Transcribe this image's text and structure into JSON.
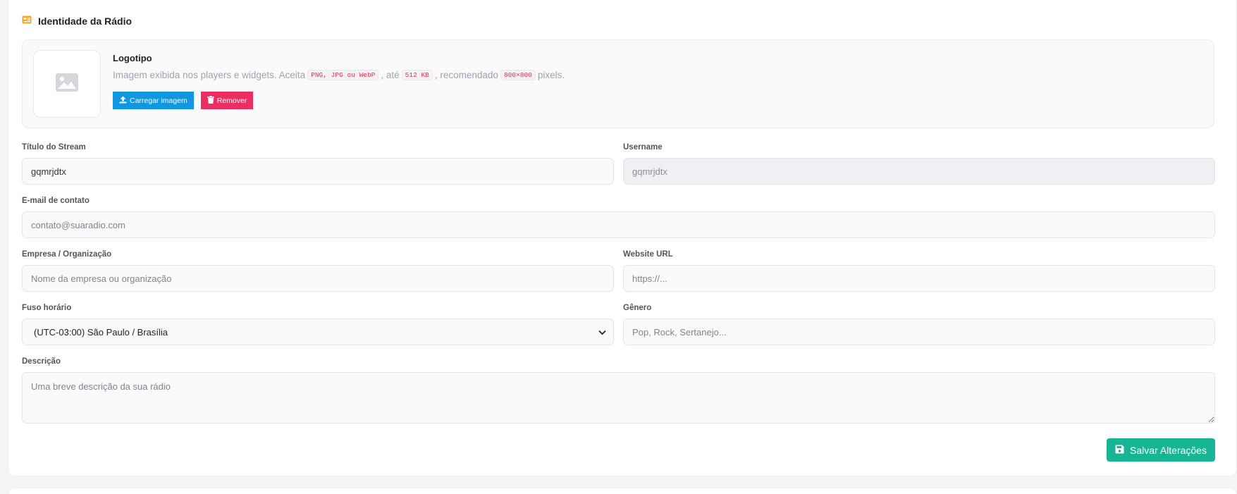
{
  "section": {
    "title": "Identidade da Rádio",
    "icon": "id-card-icon",
    "accent": "#f5a623"
  },
  "logo": {
    "title": "Logotipo",
    "desc_prefix": "Imagem exibida nos players e widgets. Aceita",
    "formats": "PNG, JPG ou WebP",
    "desc_until": ", até",
    "max_size": "512 KB",
    "desc_recommended": ", recomendado",
    "dimensions": "800×800",
    "desc_suffix": "pixels.",
    "placeholder_icon": "image-icon",
    "upload_label": "Carregar imagem",
    "remove_label": "Remover",
    "upload_color": "#1196e0",
    "remove_color": "#ec2f62"
  },
  "fields": {
    "stream_title": {
      "label": "Título do Stream",
      "value": "gqmrjdtx"
    },
    "username": {
      "label": "Username",
      "value": "gqmrjdtx"
    },
    "email": {
      "label": "E-mail de contato",
      "placeholder": "contato@suaradio.com"
    },
    "company": {
      "label": "Empresa / Organização",
      "placeholder": "Nome da empresa ou organização"
    },
    "website": {
      "label": "Website URL",
      "placeholder": "https://..."
    },
    "timezone": {
      "label": "Fuso horário",
      "selected": "(UTC-03:00) São Paulo / Brasília"
    },
    "genre": {
      "label": "Gênero",
      "placeholder": "Pop, Rock, Sertanejo..."
    },
    "description": {
      "label": "Descrição",
      "placeholder": "Uma breve descrição da sua rádio"
    }
  },
  "save": {
    "label": "Salvar Alterações",
    "icon": "save-icon",
    "color": "#16b594"
  }
}
